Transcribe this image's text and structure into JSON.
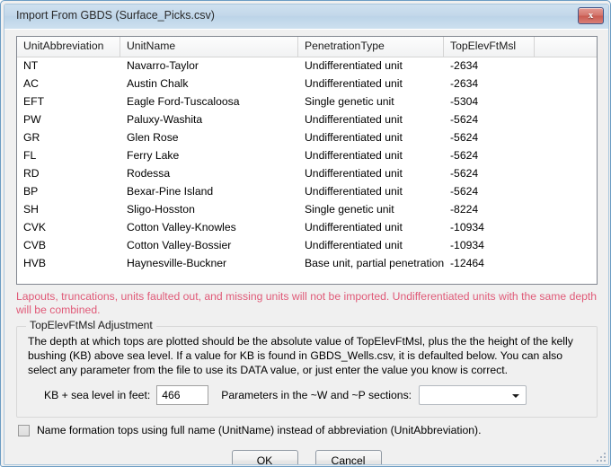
{
  "window": {
    "title": "Import From GBDS (Surface_Picks.csv)",
    "close_label": "x",
    "close_icon": "close-icon"
  },
  "grid": {
    "columns": [
      "UnitAbbreviation",
      "UnitName",
      "PenetrationType",
      "TopElevFtMsl",
      ""
    ],
    "rows": [
      [
        "NT",
        "Navarro-Taylor",
        "Undifferentiated unit",
        "-2634",
        ""
      ],
      [
        "AC",
        "Austin Chalk",
        "Undifferentiated unit",
        "-2634",
        ""
      ],
      [
        "EFT",
        "Eagle Ford-Tuscaloosa",
        "Single genetic unit",
        "-5304",
        ""
      ],
      [
        "PW",
        "Paluxy-Washita",
        "Undifferentiated unit",
        "-5624",
        ""
      ],
      [
        "GR",
        "Glen Rose",
        "Undifferentiated unit",
        "-5624",
        ""
      ],
      [
        "FL",
        "Ferry Lake",
        "Undifferentiated unit",
        "-5624",
        ""
      ],
      [
        "RD",
        "Rodessa",
        "Undifferentiated unit",
        "-5624",
        ""
      ],
      [
        "BP",
        "Bexar-Pine Island",
        "Undifferentiated unit",
        "-5624",
        ""
      ],
      [
        "SH",
        "Sligo-Hosston",
        "Single genetic unit",
        "-8224",
        ""
      ],
      [
        "CVK",
        "Cotton Valley-Knowles",
        "Undifferentiated unit",
        "-10934",
        ""
      ],
      [
        "CVB",
        "Cotton Valley-Bossier",
        "Undifferentiated unit",
        "-10934",
        ""
      ],
      [
        "HVB",
        "Haynesville-Buckner",
        "Base unit, partial penetration",
        "-12464",
        ""
      ]
    ]
  },
  "warning": {
    "text": "Lapouts, truncations, units faulted out, and missing units will not be imported. Undifferentiated units with the same depth will be combined.",
    "color": "#e05a78"
  },
  "adjustment_group": {
    "label": "TopElevFtMsl Adjustment",
    "description": "The depth at which tops are plotted should be the absolute value of TopElevFtMsl, plus the the height of the kelly bushing (KB) above sea level. If a value for KB is found in GBDS_Wells.csv, it is defaulted below. You can also select any parameter from the file to use its DATA value, or just enter the value you know is correct.",
    "kb_label": "KB + sea level in feet:",
    "kb_value": "466",
    "parameters_label": "Parameters in the ~W and ~P sections:",
    "parameters_value": "",
    "parameters_arrow_icon": "chevron-down-icon"
  },
  "fullname_option": {
    "label": "Name formation tops using full name (UnitName) instead of abbreviation (UnitAbbreviation).",
    "checked": false
  },
  "buttons": {
    "ok_label": "OK",
    "cancel_label": "Cancel"
  }
}
